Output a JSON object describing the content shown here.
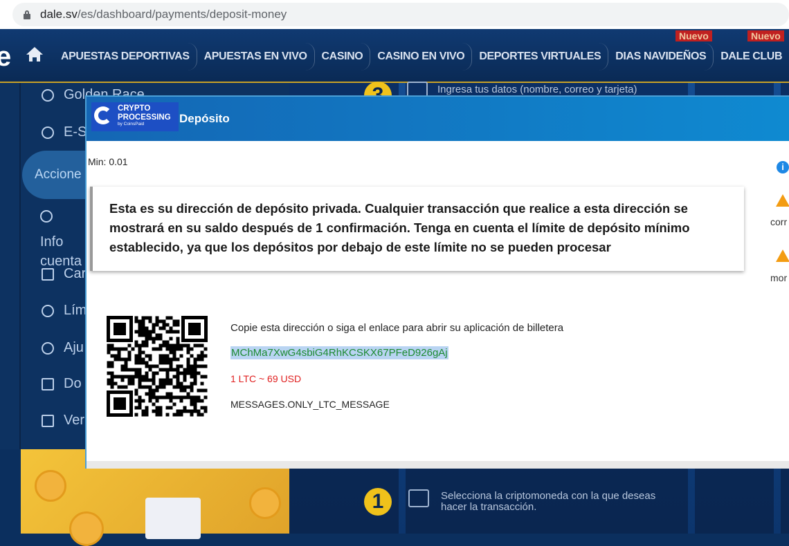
{
  "browser": {
    "url_domain": "dale.sv",
    "url_path": "/es/dashboard/payments/deposit-money"
  },
  "nav": {
    "logo_fragment": "e",
    "items": [
      "APUESTAS DEPORTIVAS",
      "APUESTAS EN VIVO",
      "CASINO",
      "CASINO EN VIVO",
      "DEPORTES VIRTUALES",
      "DIAS NAVIDEÑOS",
      "DALE CLUB"
    ],
    "badge_1": "Nuevo",
    "badge_2": "Nuevo"
  },
  "left_menu": {
    "items": [
      "Golden Race",
      "E-S",
      "Accione",
      "Info cuenta",
      "Car",
      "Lím",
      "Aju",
      "Do",
      "Ver"
    ]
  },
  "background_steps": {
    "step3_number": "3",
    "step3_text": "Ingresa tus datos (nombre, correo y tarjeta)",
    "step1_number": "1",
    "step1_text": "Selecciona la criptomoneda con la que deseas hacer la transacción."
  },
  "modal": {
    "logo_line1": "CRYPTO",
    "logo_line2": "PROCESSING",
    "logo_sub": "by CoinsPaid",
    "title": "Depósito",
    "min": "Min: 0.01",
    "notice": "Esta es su dirección de depósito privada. Cualquier transacción que realice a esta dirección se mostrará en su saldo después de 1 confirmación. Tenga en cuenta el límite de depósito mínimo establecido, ya que los depósitos por debajo de este límite no se pueden procesar",
    "copy_instruction": "Copie esta dirección o siga el enlace para abrir su aplicación de billetera",
    "address": "MChMa7XwG4sbiG4RhKCSKX67PFeD926gAj",
    "rate": "1 LTC ~ 69 USD",
    "message": "MESSAGES.ONLY_LTC_MESSAGE"
  },
  "side_panel": {
    "info_icon": "info-icon",
    "frag1": "corr",
    "frag2": "mor"
  },
  "colors": {
    "header_blue": "#1466b4",
    "address_green": "#1c8a31",
    "rate_red": "#e02020",
    "badge_red": "#c02020",
    "gold": "#f0c21b"
  }
}
